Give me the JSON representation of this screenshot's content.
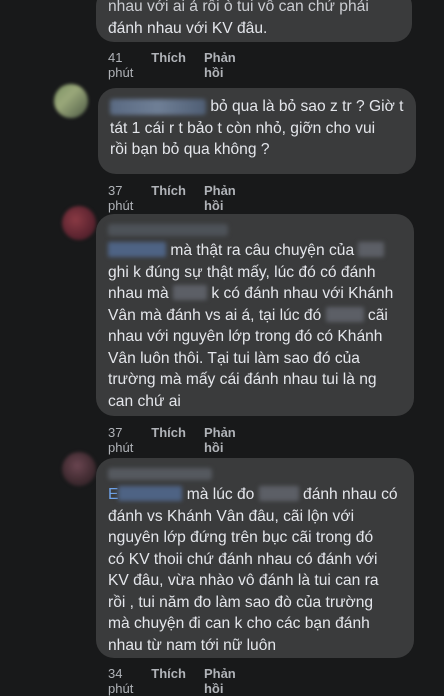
{
  "comments": [
    {
      "line1": "nhau với ai ả rồi ò tui vô can chứ phải",
      "line2": "đánh nhau với KV đâu.",
      "time": "41 phút",
      "like": "Thích",
      "reply": "Phản hồi"
    },
    {
      "line1": " bỏ qua là bỏ sao z tr ? Giờ t",
      "line2": "tát 1 cái r t bảo t còn nhỏ, giỡn cho vui",
      "line3": "rồi bạn bỏ qua không ?",
      "time": "37 phút",
      "like": "Thích",
      "reply": "Phản hồi"
    },
    {
      "l1": "mà thật ra câu chuyện của ",
      "l2a": "ghi k đúng sự thật mấy, lúc đó có đánh",
      "l3a": "nhau mà ",
      "l3b": " k có đánh nhau với Khánh",
      "l4a": "Vân mà đánh vs ai á, tại lúc đó ",
      "l4b": " cãi",
      "l5": "nhau với nguyên lớp trong đó có Khánh",
      "l6": "Vân luôn thôi. Tại tui làm sao đó của",
      "l7": "trường mà mấy cái đánh nhau tui là ng",
      "l8": "can chứ ai",
      "time": "37 phút",
      "like": "Thích",
      "reply": "Phản hồi"
    },
    {
      "l1pre": "E",
      "l1a": " mà lúc đo ",
      "l1b": " đánh nhau có",
      "l2": "đánh vs Khánh Vân đâu, cãi lộn với",
      "l3": "nguyên lớp đứng trên bục cãi trong đó",
      "l4": "có KV thoii chứ đánh nhau có đánh với",
      "l5": "KV đâu, vừa nhào vô đánh là tui can ra",
      "l6": "rồi , tui năm đo làm sao đò của trường",
      "l7": "mà chuyện đi can k cho các bạn đánh",
      "l8": "nhau từ nam tới nữ luôn",
      "time": "34 phút",
      "like": "Thích",
      "reply": "Phản hồi"
    }
  ]
}
